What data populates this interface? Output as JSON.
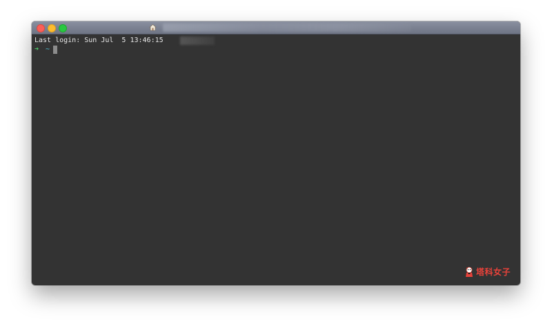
{
  "window": {
    "title_icon": "home-folder-icon"
  },
  "terminal": {
    "last_login": "Last login: Sun Jul  5 13:46:15",
    "prompt_arrow": "➜",
    "prompt_dir": "~"
  },
  "watermark": {
    "text": "塔科女子",
    "logo": "mascot-logo"
  },
  "colors": {
    "terminal_bg": "#333333",
    "titlebar": "#7c8292",
    "prompt_arrow": "#4fd16b",
    "prompt_dir": "#4fc4d8",
    "watermark": "#e8423a"
  }
}
